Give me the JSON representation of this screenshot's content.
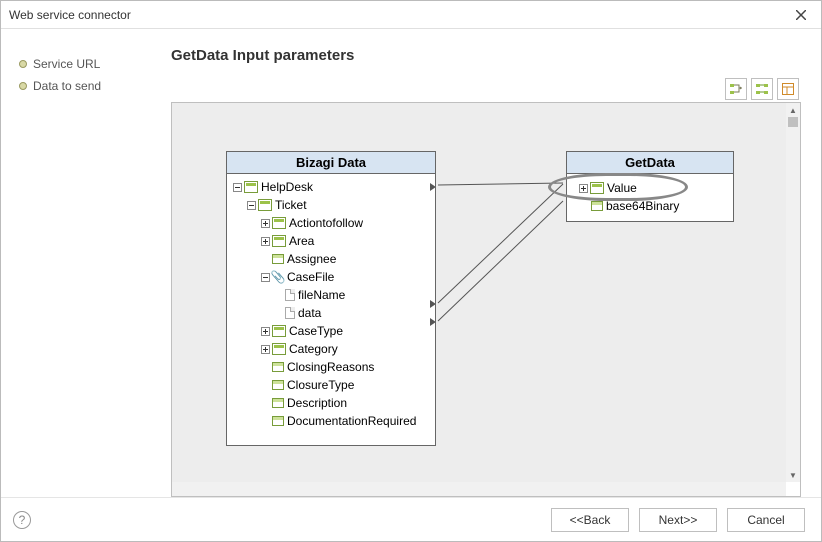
{
  "window": {
    "title": "Web service connector"
  },
  "sidebar": {
    "items": [
      {
        "label": "Service URL"
      },
      {
        "label": "Data to send"
      }
    ]
  },
  "main": {
    "heading": "GetData Input parameters"
  },
  "bizagi_box": {
    "title": "Bizagi Data",
    "tree": {
      "root": "HelpDesk",
      "ticket": "Ticket",
      "items": [
        "Actiontofollow",
        "Area",
        "Assignee",
        "CaseFile",
        "fileName",
        "data",
        "CaseType",
        "Category",
        "ClosingReasons",
        "ClosureType",
        "Description",
        "DocumentationRequired"
      ]
    }
  },
  "getdata_box": {
    "title": "GetData",
    "items": [
      "Value",
      "base64Binary"
    ]
  },
  "footer": {
    "back": "<<Back",
    "next": "Next>>",
    "cancel": "Cancel"
  }
}
